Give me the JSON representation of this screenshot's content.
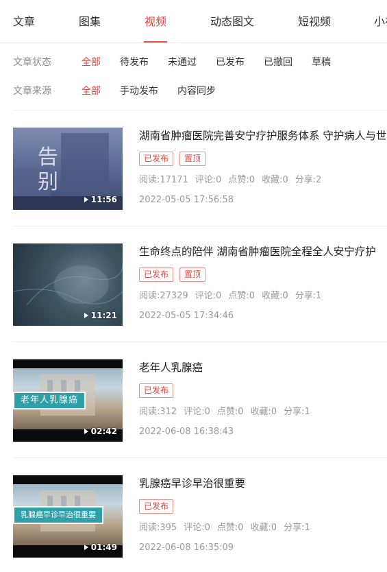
{
  "tabs": [
    {
      "label": "文章"
    },
    {
      "label": "图集"
    },
    {
      "label": "视频"
    },
    {
      "label": "动态图文"
    },
    {
      "label": "短视频"
    },
    {
      "label": "小视频"
    }
  ],
  "active_tab": "视频",
  "filters": {
    "status": {
      "label": "文章状态",
      "options": [
        "全部",
        "待发布",
        "未通过",
        "已发布",
        "已撤回",
        "草稿"
      ],
      "selected": "全部"
    },
    "source": {
      "label": "文章来源",
      "options": [
        "全部",
        "手动发布",
        "内容同步"
      ],
      "selected": "全部"
    }
  },
  "videos": [
    {
      "title": "湖南省肿瘤医院完善安宁疗护服务体系 守护病人与世界温柔告别",
      "badges": [
        "已发布",
        "置顶"
      ],
      "stats": {
        "read": "阅读:17171",
        "comment": "评论:0",
        "like": "点赞:0",
        "fav": "收藏:0",
        "share": "分享:2"
      },
      "date": "2022-05-05 17:56:58",
      "duration": "11:56",
      "thumb_text": "告 别"
    },
    {
      "title": "生命终点的陪伴 湖南省肿瘤医院全程全人安宁疗护",
      "badges": [
        "已发布",
        "置顶"
      ],
      "stats": {
        "read": "阅读:27329",
        "comment": "评论:0",
        "like": "点赞:0",
        "fav": "收藏:0",
        "share": "分享:1"
      },
      "date": "2022-05-05 17:34:46",
      "duration": "11:21"
    },
    {
      "title": "老年人乳腺癌",
      "badges": [
        "已发布"
      ],
      "stats": {
        "read": "阅读:312",
        "comment": "评论:0",
        "like": "点赞:0",
        "fav": "收藏:0",
        "share": "分享:1"
      },
      "date": "2022-06-08 16:38:43",
      "duration": "02:42",
      "thumb_text": "老年人乳腺癌"
    },
    {
      "title": "乳腺癌早诊早治很重要",
      "badges": [
        "已发布"
      ],
      "stats": {
        "read": "阅读:395",
        "comment": "评论:0",
        "like": "点赞:0",
        "fav": "收藏:0",
        "share": "分享:1"
      },
      "date": "2022-06-08 16:35:09",
      "duration": "01:49",
      "thumb_text": "乳腺癌早诊早治很重要"
    }
  ],
  "colors": {
    "accent": "#e8453c",
    "muted": "#999999"
  }
}
